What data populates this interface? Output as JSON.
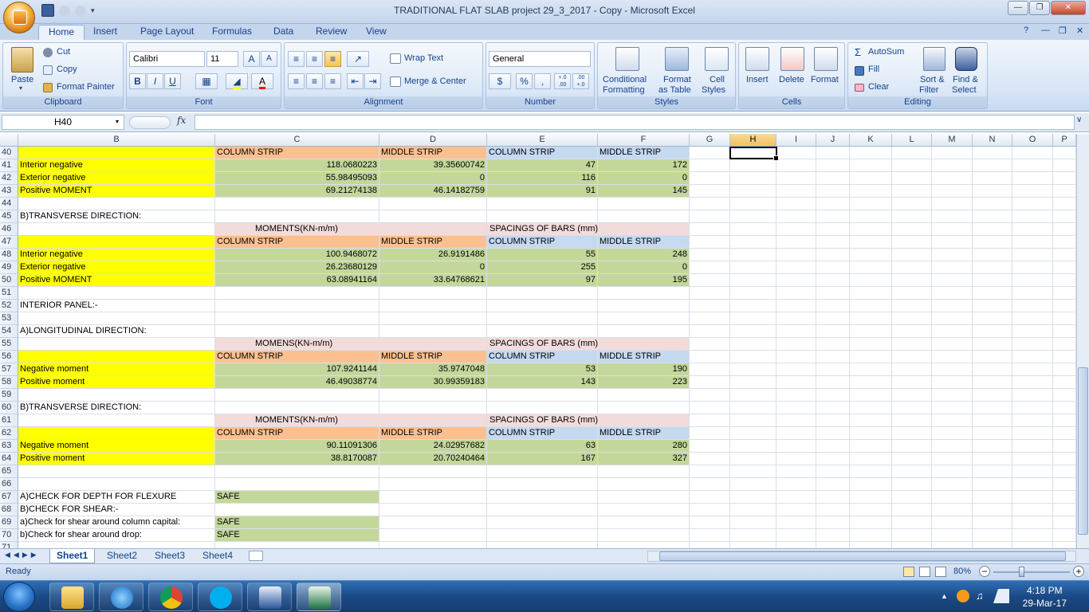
{
  "window": {
    "title": "TRADITIONAL FLAT SLAB project 29_3_2017 - Copy - Microsoft Excel"
  },
  "tabs": [
    "Home",
    "Insert",
    "Page Layout",
    "Formulas",
    "Data",
    "Review",
    "View"
  ],
  "ribbon": {
    "clipboard": {
      "label": "Clipboard",
      "paste": "Paste",
      "cut": "Cut",
      "copy": "Copy",
      "format_painter": "Format Painter"
    },
    "font": {
      "label": "Font",
      "name": "Calibri",
      "size": "11",
      "bold": "B",
      "italic": "I",
      "underline": "U",
      "grow": "A",
      "shrink": "A"
    },
    "alignment": {
      "label": "Alignment",
      "wrap": "Wrap Text",
      "merge": "Merge & Center"
    },
    "number": {
      "label": "Number",
      "format": "General",
      "currency": "$",
      "percent": "%",
      "comma": ",",
      "inc": "+.0 .00",
      "dec": ".00 +.0"
    },
    "styles": {
      "label": "Styles",
      "cond": "Conditional",
      "cond2": "Formatting",
      "table": "Format",
      "table2": "as Table",
      "cell": "Cell",
      "cell2": "Styles"
    },
    "cells": {
      "label": "Cells",
      "insert": "Insert",
      "delete": "Delete",
      "format": "Format"
    },
    "editing": {
      "label": "Editing",
      "autosum": "AutoSum",
      "fill": "Fill",
      "clear": "Clear",
      "sort": "Sort &",
      "sort2": "Filter",
      "find": "Find &",
      "find2": "Select"
    }
  },
  "formula_bar": {
    "name_box": "H40",
    "fx": "fx",
    "value": ""
  },
  "columns": [
    "B",
    "C",
    "D",
    "E",
    "F",
    "G",
    "H",
    "I",
    "J",
    "K",
    "L",
    "M",
    "N",
    "O",
    "P"
  ],
  "rows": [
    {
      "n": "40",
      "b": "",
      "c": "COLUMN STRIP",
      "d": "MIDDLE STRIP",
      "e": "COLUMN STRIP",
      "f": "MIDDLE STRIP"
    },
    {
      "n": "41",
      "b": "Interior negative",
      "c": "118.0680223",
      "d": "39.35600742",
      "e": "47",
      "f": "172"
    },
    {
      "n": "42",
      "b": "Exterior negative",
      "c": "55.98495093",
      "d": "0",
      "e": "116",
      "f": "0"
    },
    {
      "n": "43",
      "b": "Positive MOMENT",
      "c": "69.21274138",
      "d": "46.14182759",
      "e": "91",
      "f": "145"
    },
    {
      "n": "44"
    },
    {
      "n": "45",
      "b": "B)TRANSVERSE DIRECTION:"
    },
    {
      "n": "46",
      "c": "MOMENTS(KN-m/m)",
      "e": "SPACINGS OF BARS  (mm)"
    },
    {
      "n": "47",
      "b": "",
      "c": "COLUMN STRIP",
      "d": "MIDDLE STRIP",
      "e": "COLUMN STRIP",
      "f": "MIDDLE STRIP"
    },
    {
      "n": "48",
      "b": "Interior negative",
      "c": "100.9468072",
      "d": "26.9191486",
      "e": "55",
      "f": "248"
    },
    {
      "n": "49",
      "b": "Exterior negative",
      "c": "26.23680129",
      "d": "0",
      "e": "255",
      "f": "0"
    },
    {
      "n": "50",
      "b": "Positive MOMENT",
      "c": "63.08941164",
      "d": "33.64768621",
      "e": "97",
      "f": "195"
    },
    {
      "n": "51"
    },
    {
      "n": "52",
      "b": "INTERIOR PANEL:-"
    },
    {
      "n": "53"
    },
    {
      "n": "54",
      "b": "A)LONGITUDINAL DIRECTION:"
    },
    {
      "n": "55",
      "c": "MOMENS(KN-m/m)",
      "e": "SPACINGS OF BARS (mm)"
    },
    {
      "n": "56",
      "b": "",
      "c": "COLUMN STRIP",
      "d": "MIDDLE STRIP",
      "e": "COLUMN STRIP",
      "f": "MIDDLE STRIP"
    },
    {
      "n": "57",
      "b": "Negative moment",
      "c": "107.9241144",
      "d": "35.9747048",
      "e": "53",
      "f": "190"
    },
    {
      "n": "58",
      "b": "Positive moment",
      "c": "46.49038774",
      "d": "30.99359183",
      "e": "143",
      "f": "223"
    },
    {
      "n": "59"
    },
    {
      "n": "60",
      "b": "B)TRANSVERSE DIRECTION:"
    },
    {
      "n": "61",
      "c": "MOMENTS(KN-m/m)",
      "e": "SPACINGS OF BARS (mm)"
    },
    {
      "n": "62",
      "b": "",
      "c": "COLUMN STRIP",
      "d": "MIDDLE STRIP",
      "e": "COLUMN STRIP",
      "f": "MIDDLE STRIP"
    },
    {
      "n": "63",
      "b": "Negative moment",
      "c": "90.11091306",
      "d": "24.02957682",
      "e": "63",
      "f": "280"
    },
    {
      "n": "64",
      "b": "Positive moment",
      "c": "38.8170087",
      "d": "20.70240464",
      "e": "167",
      "f": "327"
    },
    {
      "n": "65"
    },
    {
      "n": "66"
    },
    {
      "n": "67",
      "b": "A)CHECK FOR DEPTH FOR FLEXURE",
      "c": "SAFE"
    },
    {
      "n": "68",
      "b": "B)CHECK FOR SHEAR:-"
    },
    {
      "n": "69",
      "b": "a)Check for shear around column capital:",
      "c": "SAFE"
    },
    {
      "n": "70",
      "b": "b)Check for shear around drop:",
      "c": "SAFE"
    },
    {
      "n": "71"
    }
  ],
  "sheets": [
    "Sheet1",
    "Sheet2",
    "Sheet3",
    "Sheet4"
  ],
  "status": {
    "ready": "Ready",
    "zoom": "80%"
  },
  "taskbar": {
    "time": "4:18 PM",
    "date": "29-Mar-17"
  }
}
